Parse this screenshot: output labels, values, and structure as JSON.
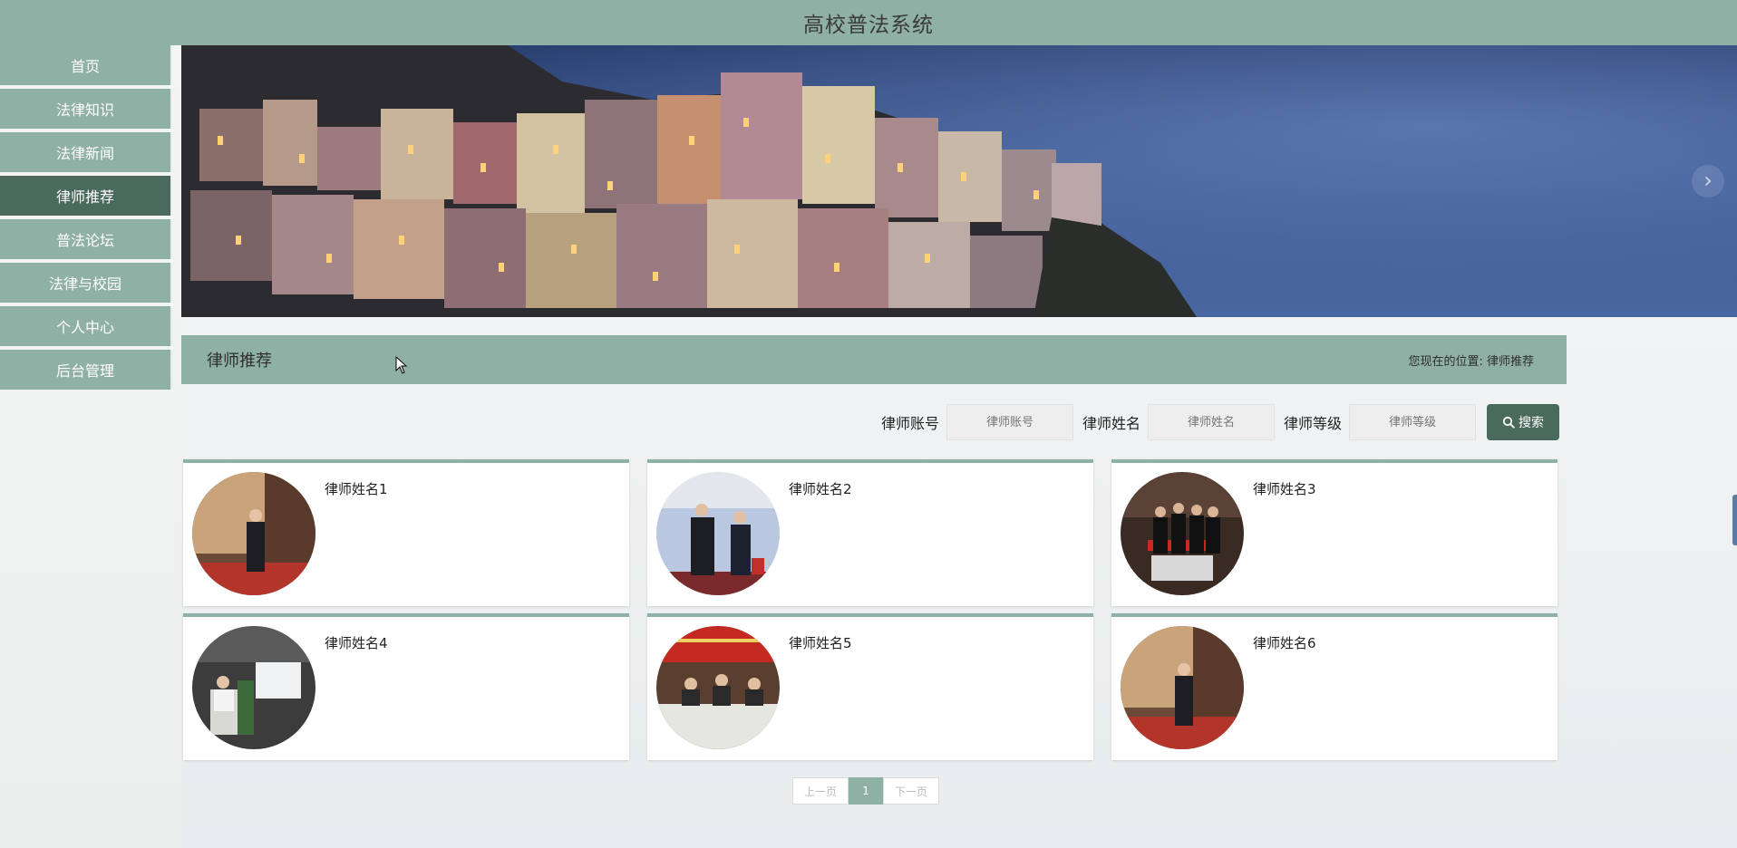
{
  "app": {
    "title": "高校普法系统"
  },
  "sidebar": {
    "items": [
      {
        "label": "首页"
      },
      {
        "label": "法律知识"
      },
      {
        "label": "法律新闻"
      },
      {
        "label": "律师推荐",
        "active": true
      },
      {
        "label": "普法论坛"
      },
      {
        "label": "法律与校园"
      },
      {
        "label": "个人中心"
      },
      {
        "label": "后台管理"
      }
    ]
  },
  "banner": {
    "next_icon": "chevron-right-icon"
  },
  "section": {
    "title": "律师推荐",
    "breadcrumb_prefix": "您现在的位置:",
    "breadcrumb_current": "律师推荐"
  },
  "search": {
    "account_label": "律师账号",
    "account_placeholder": "律师账号",
    "name_label": "律师姓名",
    "name_placeholder": "律师姓名",
    "level_label": "律师等级",
    "level_placeholder": "律师等级",
    "button_label": "搜索",
    "button_icon": "search-icon"
  },
  "lawyers": [
    {
      "name": "律师姓名1"
    },
    {
      "name": "律师姓名2"
    },
    {
      "name": "律师姓名3"
    },
    {
      "name": "律师姓名4"
    },
    {
      "name": "律师姓名5"
    },
    {
      "name": "律师姓名6"
    }
  ],
  "pager": {
    "prev": "上一页",
    "current": "1",
    "next": "下一页"
  },
  "colors": {
    "primary": "#8fb0a5",
    "primary_dark": "#4a6a5d",
    "background": "#f3f4f5"
  }
}
